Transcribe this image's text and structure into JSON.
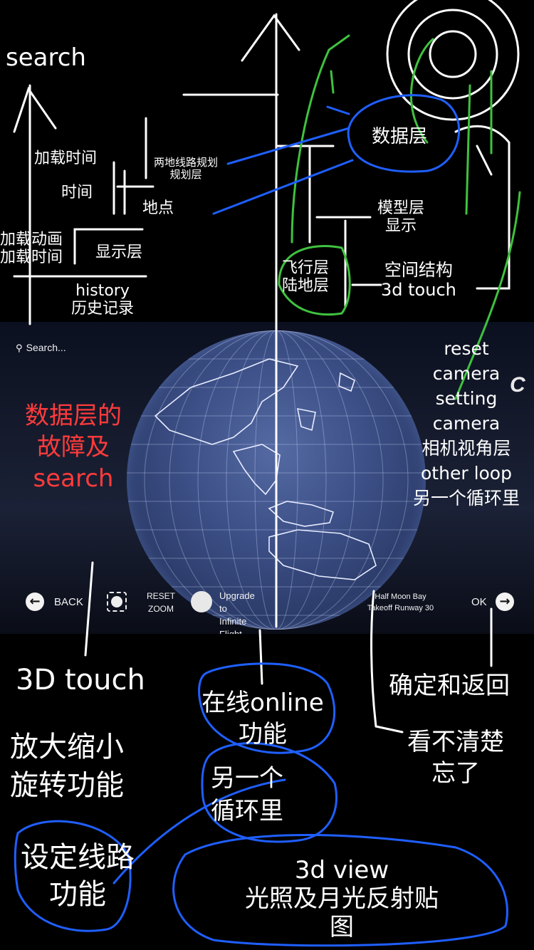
{
  "app": {
    "search_placeholder": "Search...",
    "back_label": "BACK",
    "reset_zoom": [
      "RESET",
      "ZOOM"
    ],
    "upgrade": [
      "Upgrade to",
      "Infinite Flight PRO"
    ],
    "location": [
      "Half Moon Bay",
      "Takeoff Runway 30"
    ],
    "ok_label": "OK",
    "logo_letter": "C"
  },
  "annotations": {
    "search": "search",
    "load_time_top": "加载时间",
    "time": "时间",
    "route_planning": [
      "两地线路规划",
      "规划层"
    ],
    "place": "地点",
    "load_anim": [
      "加载动画",
      "加载时间"
    ],
    "display_layer": "显示层",
    "history": [
      "history",
      "历史记录"
    ],
    "data_layer": "数据层",
    "model_layer": [
      "模型层",
      "显示"
    ],
    "flight_layer": [
      "飞行层",
      "陆地层"
    ],
    "spatial": [
      "空间结构",
      "3d touch"
    ],
    "camera": [
      "reset",
      "camera",
      "setting",
      "camera",
      "相机视角层",
      "other loop",
      "另一个循环里"
    ],
    "data_fault": [
      "数据层的",
      "故障及",
      "search"
    ],
    "touch3d": "3D touch",
    "zoom_rotate": [
      "放大缩小",
      "旋转功能"
    ],
    "online": [
      "在线online",
      "功能"
    ],
    "confirm_back": "确定和返回",
    "forgot": [
      "看不清楚",
      "忘了"
    ],
    "another_loop": [
      "另一个",
      "循环里"
    ],
    "route_set": [
      "设定线路",
      "功能"
    ],
    "view3d": [
      "3d view",
      "光照及月光反射贴",
      "图"
    ]
  },
  "colors": {
    "red": "#ff3b3b",
    "blue": "#1f5fff",
    "green": "#3fc23f"
  }
}
